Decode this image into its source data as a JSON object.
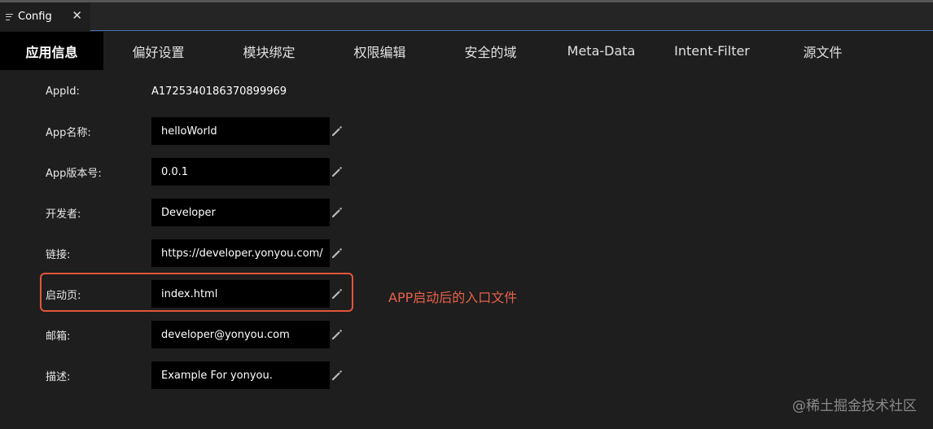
{
  "editor_tab": {
    "title": "Config",
    "close": "✕"
  },
  "nav_tabs": [
    {
      "label": "应用信息",
      "active": true
    },
    {
      "label": "偏好设置"
    },
    {
      "label": "模块绑定"
    },
    {
      "label": "权限编辑"
    },
    {
      "label": "安全的域"
    },
    {
      "label": "Meta-Data"
    },
    {
      "label": "Intent-Filter"
    },
    {
      "label": "源文件"
    }
  ],
  "form": {
    "appid": {
      "label": "AppId:",
      "value": "A1725340186370899969"
    },
    "fields": [
      {
        "label": "App名称:",
        "value": "helloWorld"
      },
      {
        "label": "App版本号:",
        "value": "0.0.1"
      },
      {
        "label": "开发者:",
        "value": "Developer"
      },
      {
        "label": "链接:",
        "value": "https://developer.yonyou.com/"
      },
      {
        "label": "启动页:",
        "value": "index.html"
      },
      {
        "label": "邮箱:",
        "value": "developer@yonyou.com"
      },
      {
        "label": "描述:",
        "value": "Example For yonyou."
      }
    ]
  },
  "annotation": {
    "text": "APP启动后的入口文件",
    "color": "#e8604a"
  },
  "watermark": "@稀土掘金技术社区",
  "colors": {
    "accent_line": "#4a6fb5",
    "highlight": "#e2553b"
  },
  "icons": {
    "edit": "pencil-icon",
    "tab": "menu-lines-icon",
    "close": "close-icon"
  }
}
